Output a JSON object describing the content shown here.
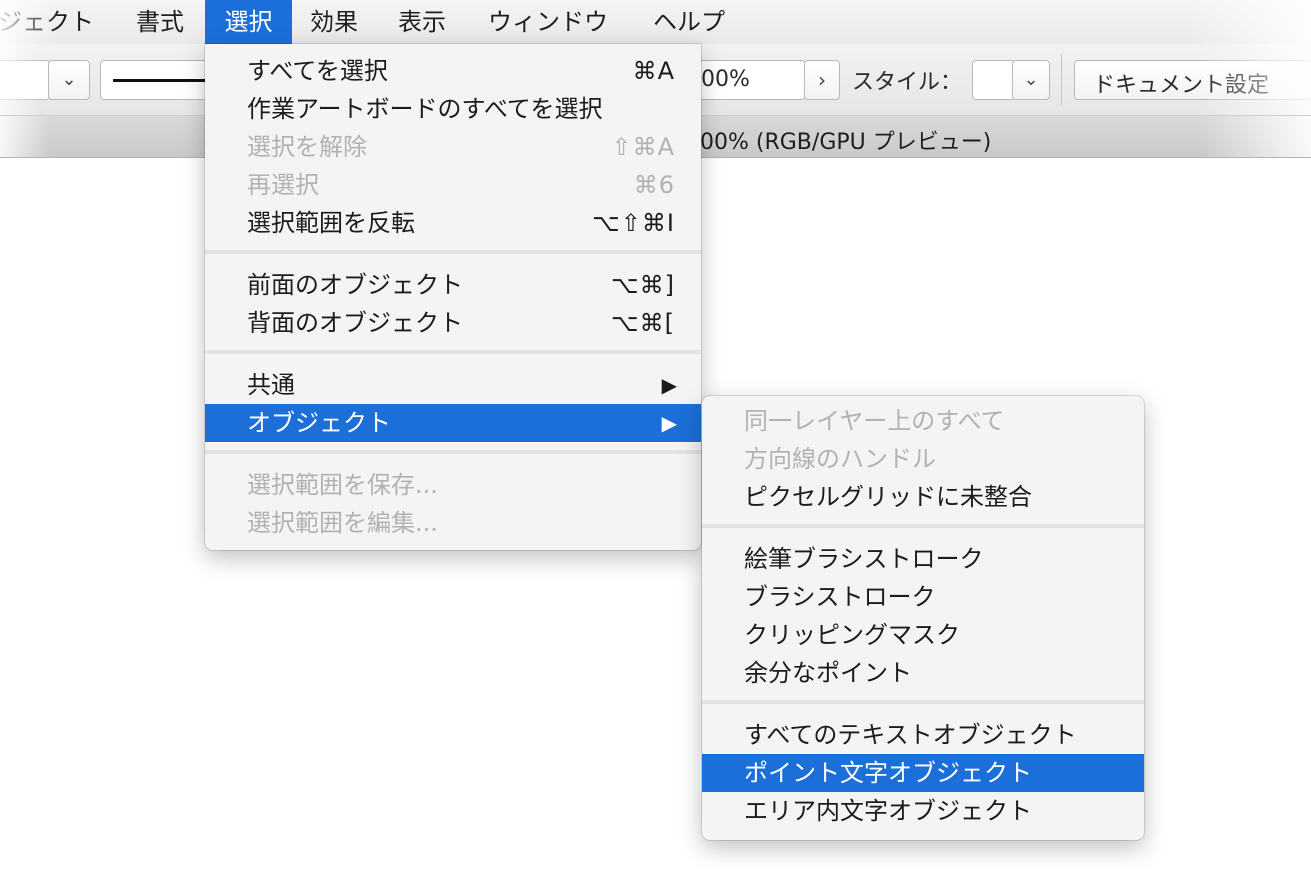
{
  "menubar": {
    "items": [
      "ジェクト",
      "書式",
      "選択",
      "効果",
      "表示",
      "ウィンドウ",
      "ヘルプ"
    ],
    "active": "選択"
  },
  "toolbar": {
    "zoom_value": "00%",
    "style_label": "スタイル：",
    "document_settings": "ドキュメント設定"
  },
  "tab": {
    "title": "00% (RGB/GPU プレビュー)"
  },
  "select_menu": {
    "groups": [
      [
        {
          "label": "すべてを選択",
          "shortcut": "⌘A",
          "enabled": true
        },
        {
          "label": "作業アートボードのすべてを選択",
          "shortcut": "",
          "enabled": true
        },
        {
          "label": "選択を解除",
          "shortcut": "⇧⌘A",
          "enabled": false
        },
        {
          "label": "再選択",
          "shortcut": "⌘6",
          "enabled": false
        },
        {
          "label": "選択範囲を反転",
          "shortcut": "⌥⇧⌘I",
          "enabled": true
        }
      ],
      [
        {
          "label": "前面のオブジェクト",
          "shortcut": "⌥⌘]",
          "enabled": true
        },
        {
          "label": "背面のオブジェクト",
          "shortcut": "⌥⌘[",
          "enabled": true
        }
      ],
      [
        {
          "label": "共通",
          "submenu": true,
          "enabled": true
        },
        {
          "label": "オブジェクト",
          "submenu": true,
          "enabled": true,
          "highlighted": true
        }
      ],
      [
        {
          "label": "選択範囲を保存...",
          "enabled": false
        },
        {
          "label": "選択範囲を編集...",
          "enabled": false
        }
      ]
    ]
  },
  "object_submenu": {
    "groups": [
      [
        {
          "label": "同一レイヤー上のすべて",
          "enabled": false
        },
        {
          "label": "方向線のハンドル",
          "enabled": false
        },
        {
          "label": "ピクセルグリッドに未整合",
          "enabled": true
        }
      ],
      [
        {
          "label": "絵筆ブラシストローク",
          "enabled": true
        },
        {
          "label": "ブラシストローク",
          "enabled": true
        },
        {
          "label": "クリッピングマスク",
          "enabled": true
        },
        {
          "label": "余分なポイント",
          "enabled": true
        }
      ],
      [
        {
          "label": "すべてのテキストオブジェクト",
          "enabled": true
        },
        {
          "label": "ポイント文字オブジェクト",
          "enabled": true,
          "highlighted": true
        },
        {
          "label": "エリア内文字オブジェクト",
          "enabled": true
        }
      ]
    ]
  },
  "icons": {
    "submenu_arrow": "▶",
    "dropdown": "chevron-down-icon",
    "stepper": "chevron-right-icon"
  },
  "colors": {
    "highlight": "#1c6fd9",
    "menu_bg": "#f4f4f4",
    "disabled_text": "#b2b2b2"
  }
}
